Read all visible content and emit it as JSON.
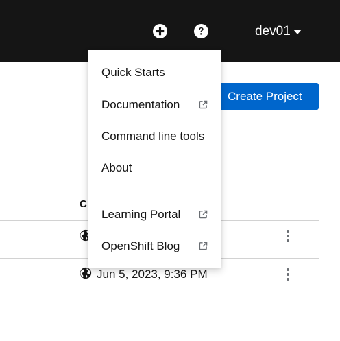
{
  "masthead": {
    "add_icon": "plus-circle-icon",
    "help_icon": "question-circle-icon",
    "user_label": "dev01"
  },
  "toolbar": {
    "create_project_label": "Create Project"
  },
  "table": {
    "column_header": "C",
    "rows": [
      {
        "created": ""
      },
      {
        "created": "Jun 5, 2023, 9:36 PM"
      }
    ]
  },
  "help_menu": {
    "items": [
      {
        "label": "Quick Starts",
        "external": false
      },
      {
        "label": "Documentation",
        "external": true
      },
      {
        "label": "Command line tools",
        "external": false
      },
      {
        "label": "About",
        "external": false
      },
      {
        "label": "Learning Portal",
        "external": true
      },
      {
        "label": "OpenShift Blog",
        "external": true
      }
    ]
  },
  "colors": {
    "masthead_bg": "#151515",
    "primary_button": "#0066cc"
  }
}
